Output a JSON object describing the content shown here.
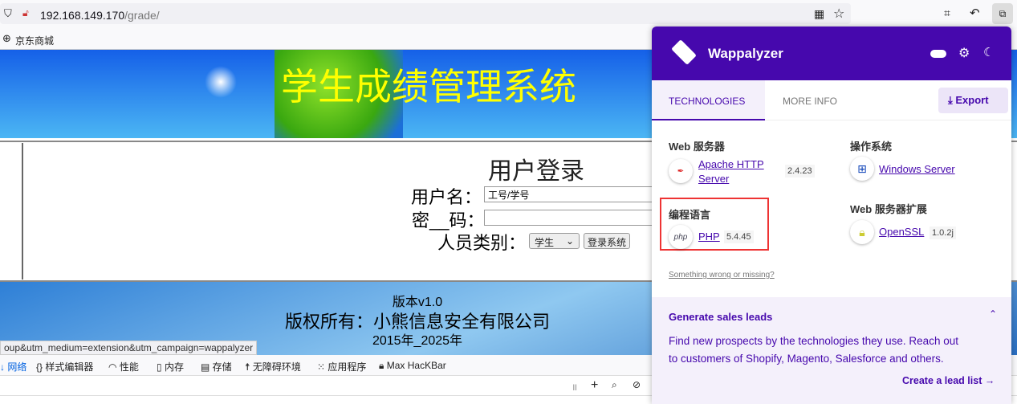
{
  "browser": {
    "url_host": "192.168.149.170",
    "url_path": "/grade/",
    "bookmark": "京东商城"
  },
  "page": {
    "title": "学生成绩管理系统",
    "login_title": "用户登录",
    "username_label": "用户名：",
    "username_value": "工号/学号",
    "password_label": "密__码：",
    "role_label": "人员类别：",
    "role_selected": "学生",
    "submit_label": "登录系统",
    "version": "版本v1.0",
    "copyright": "版权所有：小熊信息安全有限公司",
    "years": "2015年_2025年"
  },
  "status_bar": "oup&utm_medium=extension&utm_campaign=wappalyzer",
  "devtools": {
    "tabs": [
      "网络",
      "样式编辑器",
      "性能",
      "内存",
      "存储",
      "无障碍环境",
      "应用程序",
      "Max HacKBar"
    ]
  },
  "wappalyzer": {
    "name": "Wappalyzer",
    "accent": "#4608ad",
    "tabs": [
      "TECHNOLOGIES",
      "MORE INFO"
    ],
    "export": "Export",
    "categories": [
      {
        "name": "Web 服务器",
        "techs": [
          {
            "name": "Apache HTTP Server",
            "version": "2.4.23",
            "icon": "feather-icon"
          }
        ]
      },
      {
        "name": "编程语言",
        "techs": [
          {
            "name": "PHP",
            "version": "5.4.45",
            "icon": "php-icon"
          }
        ]
      },
      {
        "name": "操作系统",
        "techs": [
          {
            "name": "Windows Server",
            "icon": "windows-icon"
          }
        ]
      },
      {
        "name": "Web 服务器扩展",
        "techs": [
          {
            "name": "OpenSSL",
            "version": "1.0.2j",
            "icon": "lock-icon"
          }
        ]
      }
    ],
    "feedback": "Something wrong or missing?",
    "leads": {
      "title": "Generate sales leads",
      "text": "Find new prospects by the technologies they use. Reach out to customers of Shopify, Magento, Salesforce and others.",
      "cta": "Create a lead list"
    }
  }
}
